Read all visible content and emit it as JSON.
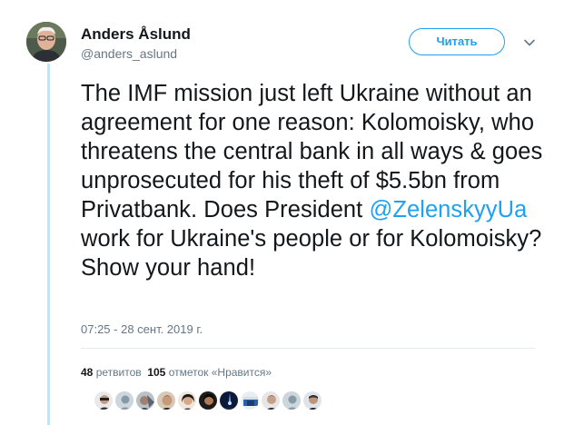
{
  "author": {
    "name": "Anders Åslund",
    "handle": "@anders_aslund",
    "avatar_icon": "profile-photo"
  },
  "follow_button": {
    "label": "Читать"
  },
  "menu": {
    "icon": "chevron-down-icon"
  },
  "tweet": {
    "text_before_mention": "The IMF mission just left Ukraine without an agreement for one reason: Kolomoisky, who threatens the central bank in all ways & goes unprosecuted for his theft of $5.5bn from Privatbank. Does President ",
    "mention": "@ZelenskyyUa",
    "text_after_mention": " work for Ukraine's people or for Kolomoisky? Show your hand!",
    "timestamp": "07:25 - 28 сент. 2019 г."
  },
  "stats": {
    "retweets_count": "48",
    "retweets_label": "ретвитов",
    "likes_count": "105",
    "likes_label": "отметок «Нравится»"
  },
  "likers": [
    {
      "icon": "liker-avatar-1"
    },
    {
      "icon": "liker-avatar-2"
    },
    {
      "icon": "liker-avatar-3"
    },
    {
      "icon": "liker-avatar-4"
    },
    {
      "icon": "liker-avatar-5"
    },
    {
      "icon": "liker-avatar-6"
    },
    {
      "icon": "liker-avatar-7"
    },
    {
      "icon": "liker-avatar-8"
    },
    {
      "icon": "liker-avatar-9"
    }
  ],
  "colors": {
    "accent": "#1da1f2",
    "text": "#14171a",
    "secondary_text": "#657786",
    "thread_line": "#c4e4f6"
  }
}
